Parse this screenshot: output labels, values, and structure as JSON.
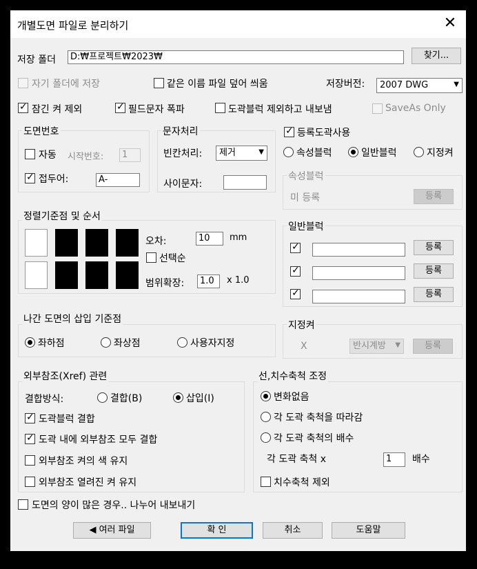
{
  "window": {
    "title": "개별도면 파일로 분리하기",
    "close_glyph": "✕"
  },
  "save_folder": {
    "label": "저장 폴더",
    "value": "D:₩프로젝트₩2023₩",
    "browse_button": "찾기..."
  },
  "row1": {
    "own_folder": "자기 폴더에 저장",
    "overwrite": "같은 이름 파일 덮어 씌움",
    "version_label": "저장버전:",
    "version_value": "2007 DWG"
  },
  "row2": {
    "locked_layers": "잠긴 켜 제외",
    "field_text": "필드문자 폭파",
    "export_except_block": "도곽블럭 제외하고 내보냄",
    "saveas_only": "SaveAs Only"
  },
  "drawing_number": {
    "title": "도면번호",
    "auto": "자동",
    "start_label": "시작번호:",
    "start_value": "1",
    "prefix": "접두어:",
    "prefix_value": "A-"
  },
  "text_proc": {
    "title": "문자처리",
    "blank_label": "빈칸처리:",
    "blank_value": "제거",
    "sep_label": "사이문자:",
    "sep_value": ""
  },
  "register": {
    "label": "등록도곽사용",
    "attr_block": "속성블럭",
    "general_block": "일반블럭",
    "layer": "지정켜"
  },
  "attr_group": {
    "title": "속성블럭",
    "status": "미 등록",
    "button": "등록"
  },
  "align": {
    "title": "정렬기준점 및 순서",
    "error_label": "오차:",
    "error_value": "10",
    "unit": "mm",
    "select_order": "선택순",
    "range_label": "범위확장:",
    "range_value": "1.0",
    "range_suffix": "x 1.0"
  },
  "general_group": {
    "title": "일반블럭",
    "button": "등록"
  },
  "insertion": {
    "title": "나간 도면의 삽입 기준점",
    "bottom_left": "좌하점",
    "top_left": "좌상점",
    "user": "사용자지정"
  },
  "layer_group": {
    "title": "지정켜",
    "x": "X",
    "select": "반시계방",
    "button": "등록"
  },
  "xref": {
    "title": "외부참조(Xref) 관련",
    "bind_label": "결합방식:",
    "bind": "결합(B)",
    "insert": "삽입(I)",
    "block_bind": "도곽블럭 결합",
    "bind_all": "도곽 내에 외부참조 모두 결합",
    "keep_color": "외부참조 켜의 색 유지",
    "keep_open": "외부참조 열려진 켜 유지"
  },
  "scale": {
    "title": "선,치수축척 조정",
    "no_change": "변화없음",
    "follow": "각 도곽 축척을 따라감",
    "multiple": "각 도곽 축척의 배수",
    "each_label": "각 도곽 축척 x",
    "each_value": "1",
    "times": "배수",
    "exclude_dim": "치수축척 제외"
  },
  "split_export": "도면의 양이 많은 경우.. 나누어 내보내기",
  "buttons": {
    "multiple_files": "◀ 여러 파일",
    "ok": "확 인",
    "cancel": "취소",
    "help": "도움말"
  }
}
